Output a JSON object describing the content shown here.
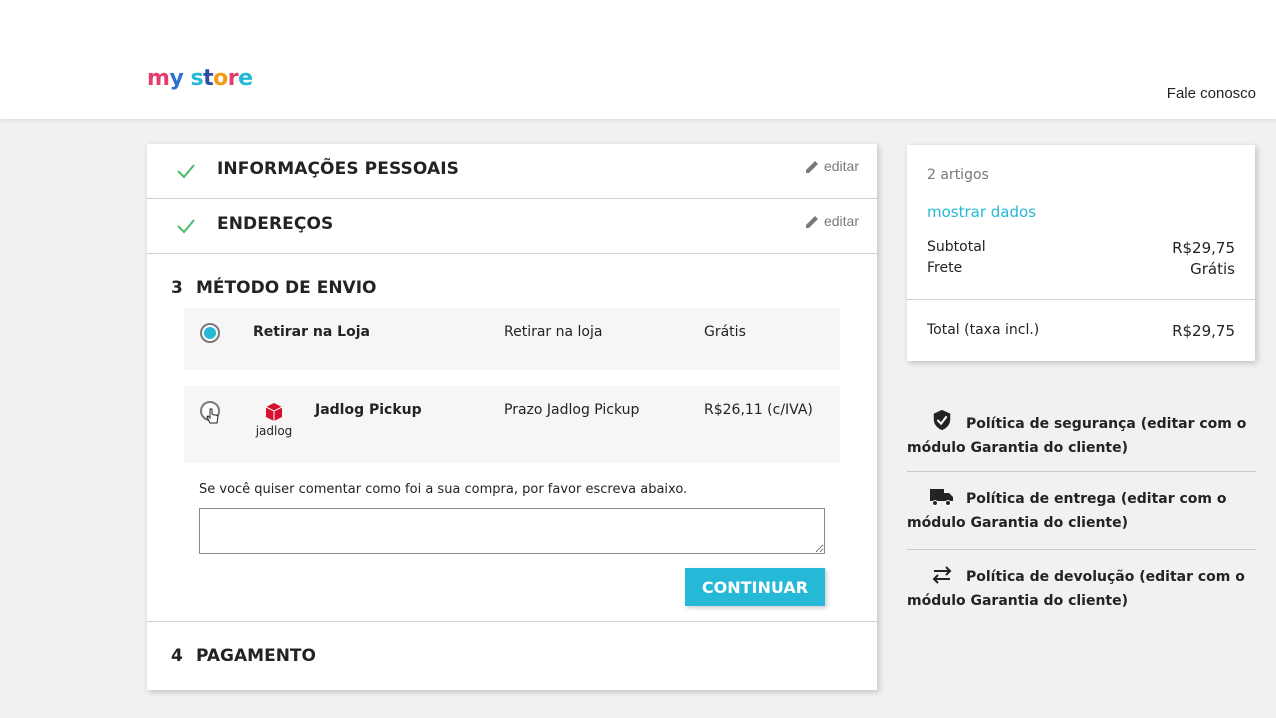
{
  "header": {
    "logo_text": "my store",
    "contact_link": "Fale conosco"
  },
  "steps": {
    "personal": {
      "title": "INFORMAÇÕES PESSOAIS",
      "edit": "editar"
    },
    "addresses": {
      "title": "ENDEREÇOS",
      "edit": "editar"
    },
    "delivery": {
      "number": "3",
      "title": "MÉTODO DE ENVIO",
      "options": [
        {
          "name": "Retirar na Loja",
          "delay": "Retirar na loja",
          "price": "Grátis",
          "selected": true
        },
        {
          "name": "Jadlog Pickup",
          "delay": "Prazo Jadlog Pickup",
          "price": "R$26,11 (c/IVA)",
          "selected": false,
          "logo_text": "jadlog"
        }
      ],
      "comment_label": "Se você quiser comentar como foi a sua compra, por favor escreva abaixo.",
      "comment_value": "",
      "continue_label": "CONTINUAR"
    },
    "payment": {
      "number": "4",
      "title": "PAGAMENTO"
    }
  },
  "cart": {
    "count": "2 artigos",
    "show_details": "mostrar dados",
    "subtotal_label": "Subtotal",
    "subtotal_value": "R$29,75",
    "shipping_label": "Frete",
    "shipping_value": "Grátis",
    "total_label": "Total (taxa incl.)",
    "total_value": "R$29,75"
  },
  "reassurance": [
    {
      "icon": "shield-check-icon",
      "text": "Política de segurança (editar com o módulo Garantia do cliente)"
    },
    {
      "icon": "truck-icon",
      "text": "Política de entrega (editar com o módulo Garantia do cliente)"
    },
    {
      "icon": "swap-arrows-icon",
      "text": "Política de devolução (editar com o módulo Garantia do cliente)"
    }
  ],
  "colors": {
    "accent": "#25b9d7",
    "check": "#4cbb6c",
    "jadlog_red": "#d8102f"
  }
}
